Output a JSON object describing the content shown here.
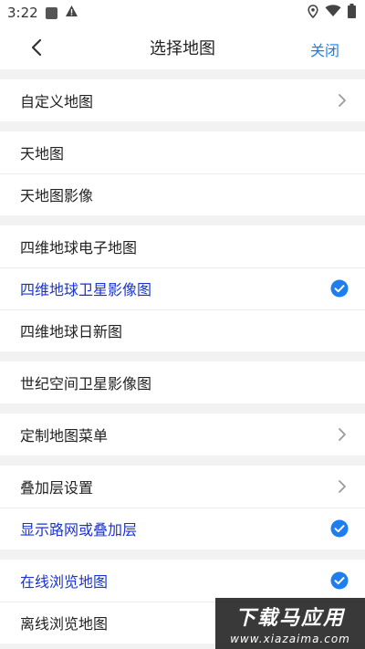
{
  "status_bar": {
    "time": "3:22",
    "icons": [
      "notification-square-icon",
      "warning-icon",
      "location-icon",
      "wifi-icon",
      "battery-icon"
    ]
  },
  "header": {
    "back_icon": "chevron-left-icon",
    "title": "选择地图",
    "close_label": "关闭"
  },
  "sections": [
    {
      "items": [
        {
          "label": "自定义地图",
          "trailing": "chevron"
        }
      ]
    },
    {
      "items": [
        {
          "label": "天地图"
        },
        {
          "label": "天地图影像"
        }
      ]
    },
    {
      "items": [
        {
          "label": "四维地球电子地图"
        },
        {
          "label": "四维地球卫星影像图",
          "selected": true,
          "trailing": "check"
        },
        {
          "label": "四维地球日新图"
        }
      ]
    },
    {
      "items": [
        {
          "label": "世纪空间卫星影像图"
        }
      ]
    },
    {
      "items": [
        {
          "label": "定制地图菜单",
          "trailing": "chevron"
        }
      ]
    },
    {
      "items": [
        {
          "label": "叠加层设置",
          "trailing": "chevron"
        },
        {
          "label": "显示路网或叠加层",
          "selected": true,
          "trailing": "check"
        }
      ]
    },
    {
      "items": [
        {
          "label": "在线浏览地图",
          "selected": true,
          "trailing": "check"
        },
        {
          "label": "离线浏览地图"
        }
      ]
    }
  ],
  "watermark": {
    "title": "下载马应用",
    "url": "www.xiazaima.com"
  },
  "colors": {
    "accent": "#1e7ef0",
    "selected_text": "#1a32d6",
    "background": "#f2f2f2"
  }
}
